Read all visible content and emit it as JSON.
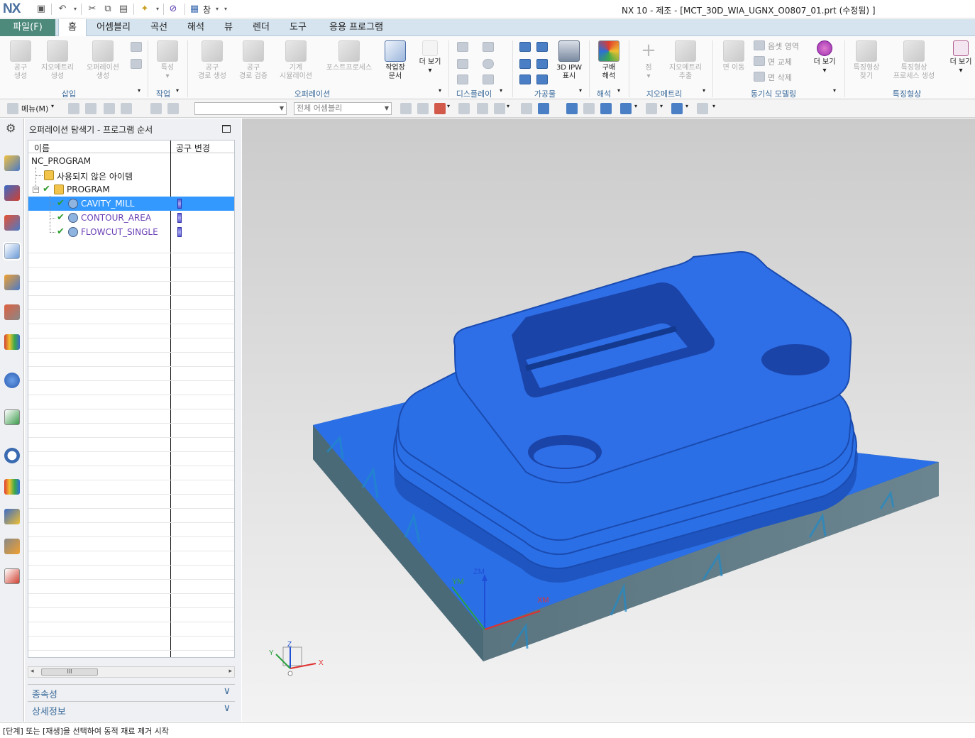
{
  "app": {
    "logo": "NX",
    "window_title": "NX 10 - 제조 - [MCT_30D_WIA_UGNX_O0807_01.prt (수정됨) ]",
    "quick_access_window_label": "창"
  },
  "menu": {
    "file": "파일(F)",
    "tabs": [
      "홈",
      "어셈블리",
      "곡선",
      "해석",
      "뷰",
      "렌더",
      "도구",
      "응용 프로그램"
    ]
  },
  "ribbon": {
    "buttons": {
      "tool_create": "공구\n생성",
      "geometry_create": "지오메트리\n생성",
      "operation_create": "오퍼레이션\n생성",
      "property": "특성",
      "toolpath_create": "공구\n경로 생성",
      "toolpath_verify": "공구\n경로 검증",
      "machine_sim": "기계\n시뮬레이션",
      "postprocess": "포스트프로세스",
      "shop_doc": "작업장\n문서",
      "more1": "더 보기",
      "ipw3d": "3D IPW\n표시",
      "slope_analysis": "구배\n해석",
      "point": "점",
      "geom_extract": "지오메트리\n추출",
      "face_move": "면 이동",
      "offset_region": "옵셋 영역",
      "face_replace": "면 교체",
      "face_delete": "면 삭제",
      "more2": "더 보기",
      "feature_find": "특징형상\n찾기",
      "feature_process": "특징형상\n프로세스 생성",
      "more3": "더 보기"
    },
    "groups": [
      "삽입",
      "작업",
      "오퍼레이션",
      "디스플레이",
      "가공물",
      "해석",
      "지오메트리",
      "동기식 모델링",
      "특징형상"
    ]
  },
  "toolbar": {
    "menu_label": "메뉴(M)",
    "filter_combo": "",
    "scope_combo": "전체 어셈블리"
  },
  "navigator": {
    "title": "오퍼레이션 탐색기 - 프로그램 순서",
    "col_name": "이름",
    "col_tool_change": "공구 변경",
    "rows": [
      {
        "label": "NC_PROGRAM"
      },
      {
        "label": "사용되지 않은 아이템"
      },
      {
        "label": "PROGRAM"
      },
      {
        "label": "CAVITY_MILL"
      },
      {
        "label": "CONTOUR_AREA"
      },
      {
        "label": "FLOWCUT_SINGLE"
      }
    ],
    "selected_row": "CAVITY_MILL",
    "scroll_thumb": "III",
    "accordion": [
      "종속성",
      "상세정보"
    ]
  },
  "viewport": {
    "axis_labels": {
      "zm": "ZM",
      "ym": "YM",
      "xm": "XM",
      "x": "X",
      "y": "Y",
      "z": "Z"
    },
    "colors": {
      "part_blue": "#2b6fe6",
      "background_top": "#cbcbcb",
      "background_bottom": "#f3f3f3"
    }
  },
  "status": {
    "message": "[단계] 또는 [재생]을 선택하여 동적 재료 제거 시작"
  }
}
